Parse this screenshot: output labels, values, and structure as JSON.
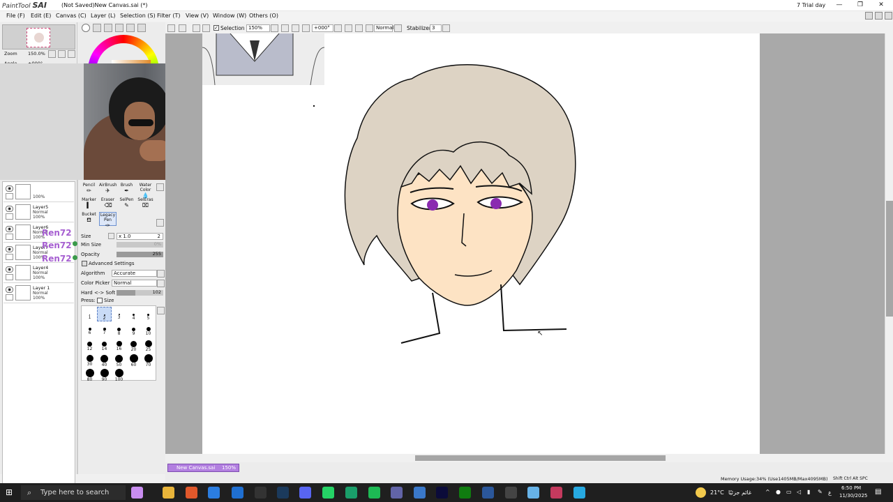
{
  "window": {
    "app_name": "SAI",
    "app_prefix": "PaintTool",
    "title": "(Not Saved)New Canvas.sai (*)",
    "trial": "7 Trial day"
  },
  "menu": [
    "File (F)",
    "Edit (E)",
    "Canvas (C)",
    "Layer (L)",
    "Selection (S)",
    "Filter (T)",
    "View (V)",
    "Window (W)",
    "Others (O)"
  ],
  "toolbar": {
    "selection_label": "Selection",
    "zoom": "150%",
    "angle": "+000°",
    "blend": "Normal",
    "stabilizer_label": "Stabilizer",
    "stabilizer_value": "3"
  },
  "navigator": {
    "zoom_label": "Zoom",
    "zoom_value": "150.0%",
    "angle_label": "Angle",
    "angle_value": "+000°"
  },
  "layers": [
    {
      "name": "",
      "mode": "",
      "opacity": "100%"
    },
    {
      "name": "Layer5",
      "mode": "Normal",
      "opacity": "100%"
    },
    {
      "name": "Layer6",
      "mode": "Normal",
      "opacity": "100%"
    },
    {
      "name": "Layer7",
      "mode": "Normal",
      "opacity": "100%"
    },
    {
      "name": "Layer4",
      "mode": "Normal",
      "opacity": "100%"
    },
    {
      "name": "Layer 1",
      "mode": "Normal",
      "opacity": "100%"
    }
  ],
  "watermark": "Ren72",
  "tools": [
    {
      "label": "Pencil",
      "icon": "pencil-icon"
    },
    {
      "label": "AirBrush",
      "icon": "airbrush-icon"
    },
    {
      "label": "Brush",
      "icon": "brush-icon"
    },
    {
      "label": "Water Color",
      "icon": "watercolor-icon"
    },
    {
      "label": "Marker",
      "icon": "marker-icon"
    },
    {
      "label": "Eraser",
      "icon": "eraser-icon"
    },
    {
      "label": "SelPen",
      "icon": "selpen-icon"
    },
    {
      "label": "SelEras",
      "icon": "seleras-icon"
    },
    {
      "label": "Bucket",
      "icon": "bucket-icon"
    },
    {
      "label": "Legacy Pen",
      "icon": "legacy-pen-icon"
    }
  ],
  "brush_props": {
    "size_label": "Size",
    "size_mult": "x 1.0",
    "size_value": "2",
    "min_size_label": "Min Size",
    "min_size_value": "0%",
    "opacity_label": "Opacity",
    "opacity_value": "255",
    "advanced_label": "Advanced Settings",
    "algorithm_label": "Algorithm",
    "algorithm_value": "Accurate",
    "color_picker_label": "Color Picker",
    "color_picker_value": "Normal",
    "hardsoft_label": "Hard <-> Soft",
    "hardsoft_value": "102",
    "press_label": "Press:",
    "press_size": "Size"
  },
  "brush_sizes": [
    "1",
    "2",
    "3",
    "4",
    "5",
    "6",
    "7",
    "8",
    "9",
    "10",
    "12",
    "14",
    "16",
    "20",
    "25",
    "30",
    "40",
    "50",
    "60",
    "70",
    "80",
    "90",
    "100"
  ],
  "doc_tab": {
    "name": "New Canvas.sai",
    "zoom": "150%"
  },
  "status": {
    "memory": "Memory Usage:34% (Use1405MB/Max4095MB)",
    "keys": "Shift Ctrl Alt SPC"
  },
  "taskbar": {
    "search_placeholder": "Type here to search",
    "weather": "21°C",
    "weather_text": "غائم جزئيًا",
    "time": "6:50 PM",
    "date": "11/30/2025",
    "lang": "ع"
  },
  "colors": {
    "accent": "#b27fe0",
    "watermark": "#a65fd1",
    "hair": "#ddd3c4",
    "skin": "#fde3c4",
    "eye": "#8a2bb0"
  }
}
